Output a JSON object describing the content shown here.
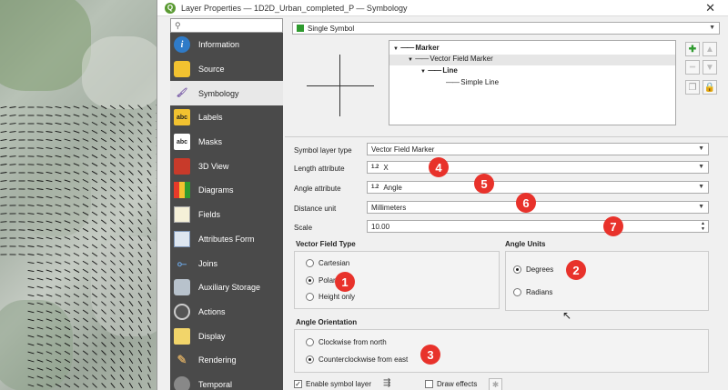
{
  "window": {
    "title": "Layer Properties — 1D2D_Urban_completed_P — Symbology",
    "close_glyph": "✕",
    "app_icon_letter": "Q"
  },
  "nav": {
    "search_icon": "search-icon",
    "items": [
      {
        "label": "Information",
        "icon": "info-icon"
      },
      {
        "label": "Source",
        "icon": "source-icon"
      },
      {
        "label": "Symbology",
        "icon": "symbology-icon",
        "active": true
      },
      {
        "label": "Labels",
        "icon": "labels-icon"
      },
      {
        "label": "Masks",
        "icon": "masks-icon"
      },
      {
        "label": "3D View",
        "icon": "3d-view-icon"
      },
      {
        "label": "Diagrams",
        "icon": "diagrams-icon"
      },
      {
        "label": "Fields",
        "icon": "fields-icon"
      },
      {
        "label": "Attributes Form",
        "icon": "attributes-form-icon"
      },
      {
        "label": "Joins",
        "icon": "joins-icon"
      },
      {
        "label": "Auxiliary Storage",
        "icon": "auxiliary-storage-icon"
      },
      {
        "label": "Actions",
        "icon": "actions-icon"
      },
      {
        "label": "Display",
        "icon": "display-icon"
      },
      {
        "label": "Rendering",
        "icon": "rendering-icon"
      },
      {
        "label": "Temporal",
        "icon": "temporal-icon"
      }
    ],
    "badges": {
      "labels": "abc",
      "masks": "abc"
    }
  },
  "renderer": {
    "value": "Single Symbol"
  },
  "tree": {
    "marker": "Marker",
    "vector_field_marker": "Vector Field Marker",
    "line": "Line",
    "simple_line": "Simple Line"
  },
  "form": {
    "symbol_layer_type_label": "Symbol layer type",
    "symbol_layer_type_value": "Vector Field Marker",
    "length_attribute_label": "Length attribute",
    "length_attribute_badge": "1.2",
    "length_attribute_value": "X",
    "angle_attribute_label": "Angle attribute",
    "angle_attribute_badge": "1.2",
    "angle_attribute_value": "Angle",
    "distance_unit_label": "Distance unit",
    "distance_unit_value": "Millimeters",
    "scale_label": "Scale",
    "scale_value": "10.00"
  },
  "vector_field_type": {
    "title": "Vector Field Type",
    "options": [
      "Cartesian",
      "Polar",
      "Height only"
    ],
    "selected": "Polar"
  },
  "angle_units": {
    "title": "Angle Units",
    "options": [
      "Degrees",
      "Radians"
    ],
    "selected": "Degrees"
  },
  "angle_orientation": {
    "title": "Angle Orientation",
    "options": [
      "Clockwise from north",
      "Counterclockwise from east"
    ],
    "selected": "Counterclockwise from east"
  },
  "footer": {
    "enable_symbol_layer": "Enable symbol layer",
    "enable_checked": true,
    "draw_effects": "Draw effects",
    "draw_effects_checked": false
  },
  "callouts": [
    "1",
    "2",
    "3",
    "4",
    "5",
    "6",
    "7"
  ],
  "colors": {
    "callout": "#e8322b",
    "nav_bg": "#4a4a4a",
    "add_green": "#2e9a2e"
  }
}
